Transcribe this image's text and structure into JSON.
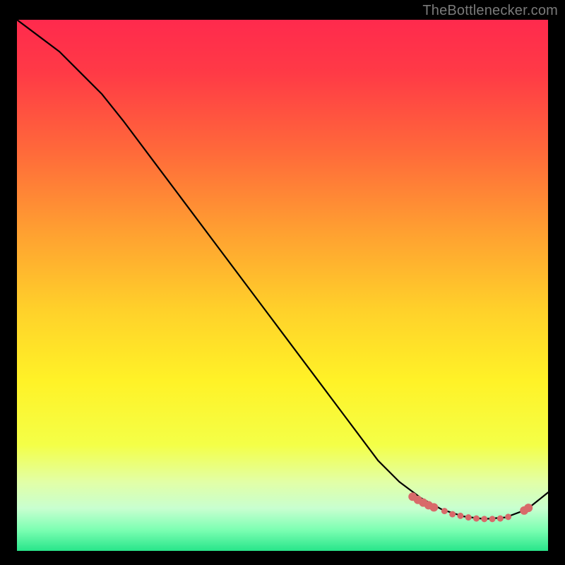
{
  "attribution": "TheBottlenecker.com",
  "chart_data": {
    "type": "line",
    "title": "",
    "xlabel": "",
    "ylabel": "",
    "xlim": [
      0,
      100
    ],
    "ylim": [
      0,
      100
    ],
    "series": [
      {
        "name": "curve",
        "x": [
          0,
          4,
          8,
          12,
          16,
          20,
          26,
          32,
          38,
          44,
          50,
          56,
          62,
          68,
          72,
          76,
          80,
          84,
          88,
          92,
          96,
          100
        ],
        "y": [
          100,
          97,
          94,
          90,
          86,
          81,
          73,
          65,
          57,
          49,
          41,
          33,
          25,
          17,
          13,
          10,
          7.8,
          6.5,
          6.0,
          6.3,
          7.8,
          11
        ]
      }
    ],
    "markers": {
      "name": "highlight-points",
      "color": "#d86a6a",
      "big_radius": 6,
      "small_radius": 4.5,
      "points": [
        {
          "x": 74.5,
          "y": 10.2,
          "r": "big"
        },
        {
          "x": 75.5,
          "y": 9.6,
          "r": "big"
        },
        {
          "x": 76.5,
          "y": 9.1,
          "r": "big"
        },
        {
          "x": 77.5,
          "y": 8.6,
          "r": "big"
        },
        {
          "x": 78.5,
          "y": 8.2,
          "r": "big"
        },
        {
          "x": 80.5,
          "y": 7.5,
          "r": "small"
        },
        {
          "x": 82.0,
          "y": 6.9,
          "r": "small"
        },
        {
          "x": 83.5,
          "y": 6.6,
          "r": "small"
        },
        {
          "x": 85.0,
          "y": 6.3,
          "r": "small"
        },
        {
          "x": 86.5,
          "y": 6.1,
          "r": "small"
        },
        {
          "x": 88.0,
          "y": 6.0,
          "r": "small"
        },
        {
          "x": 89.5,
          "y": 6.0,
          "r": "small"
        },
        {
          "x": 91.0,
          "y": 6.1,
          "r": "small"
        },
        {
          "x": 92.5,
          "y": 6.4,
          "r": "small"
        },
        {
          "x": 95.5,
          "y": 7.6,
          "r": "big"
        },
        {
          "x": 96.3,
          "y": 8.1,
          "r": "big"
        }
      ]
    },
    "gradient_stops": [
      {
        "offset": 0.0,
        "color": "#ff2a4d"
      },
      {
        "offset": 0.1,
        "color": "#ff3a46"
      },
      {
        "offset": 0.25,
        "color": "#ff6a3a"
      },
      {
        "offset": 0.4,
        "color": "#ffa031"
      },
      {
        "offset": 0.55,
        "color": "#ffd22a"
      },
      {
        "offset": 0.68,
        "color": "#fff227"
      },
      {
        "offset": 0.8,
        "color": "#f4ff47"
      },
      {
        "offset": 0.87,
        "color": "#e2ffa6"
      },
      {
        "offset": 0.92,
        "color": "#c8ffd0"
      },
      {
        "offset": 0.96,
        "color": "#7dffb3"
      },
      {
        "offset": 1.0,
        "color": "#28e58a"
      }
    ]
  }
}
